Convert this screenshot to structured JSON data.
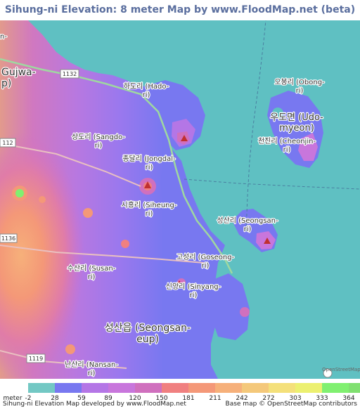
{
  "title": "Sihung-ni Elevation: 8 meter Map by www.FloodMap.net (beta)",
  "map": {
    "place_labels": [
      {
        "id": "gujwa",
        "text": "Gujwa-\np)"
      },
      {
        "id": "hado",
        "text": "하도리 (Hado-\nri)"
      },
      {
        "id": "sangdo",
        "text": "상도리 (Sangdo-\nri)"
      },
      {
        "id": "jongdal",
        "text": "종달리 (Jongdal-\nri)"
      },
      {
        "id": "siheung",
        "text": "시흥리 (Siheung-\nri)"
      },
      {
        "id": "obong",
        "text": "오봉리 (Obong-\nri)"
      },
      {
        "id": "udo",
        "text": "우도면 (Udo-\nmyeon)"
      },
      {
        "id": "cheonjin",
        "text": "천진리 (Cheonjin-\nri)"
      },
      {
        "id": "seongsanri",
        "text": "성산리 (Seongsan-\nri)"
      },
      {
        "id": "goseong",
        "text": "고성리 (Goseong-\nri)"
      },
      {
        "id": "susan",
        "text": "수산리 (Susan-\nri)"
      },
      {
        "id": "sinyang",
        "text": "신양리 (Sinyang-\nri)"
      },
      {
        "id": "seongsaneup",
        "text": "성산읍 (Seongsan-\neup)"
      },
      {
        "id": "nansan",
        "text": "난산리 (Nansan-\nri)"
      },
      {
        "id": "topleft",
        "text": "n-"
      }
    ],
    "road_labels": [
      "1132",
      "112",
      "1136",
      "1119"
    ],
    "osm_logo": "OpenStreetMap"
  },
  "legend": {
    "unit": "meter",
    "items": [
      {
        "label": "-2",
        "color": "#73c8c4"
      },
      {
        "label": "28",
        "color": "#7878f0"
      },
      {
        "label": "59",
        "color": "#b476e6"
      },
      {
        "label": "89",
        "color": "#c876dc"
      },
      {
        "label": "120",
        "color": "#d070be"
      },
      {
        "label": "150",
        "color": "#f08080"
      },
      {
        "label": "181",
        "color": "#f49878"
      },
      {
        "label": "211",
        "color": "#f6b07a"
      },
      {
        "label": "242",
        "color": "#f4c87a"
      },
      {
        "label": "272",
        "color": "#f4e07a"
      },
      {
        "label": "303",
        "color": "#ecf070"
      },
      {
        "label": "333",
        "color": "#80f070"
      },
      {
        "label": "364",
        "color": "#80e070"
      }
    ]
  },
  "footer": {
    "left": "Sihung-ni Elevation Map developed by www.FloodMap.net",
    "right": "Base map © OpenStreetMap contributors"
  }
}
